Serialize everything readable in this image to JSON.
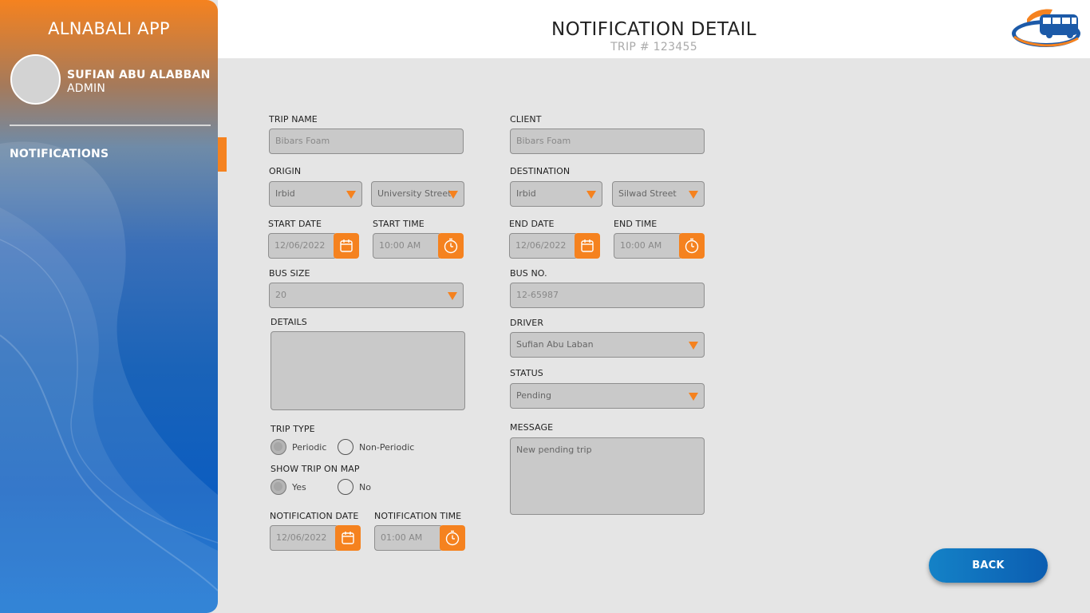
{
  "app": {
    "title": "ALNABALI APP"
  },
  "user": {
    "name": "SUFIAN ABU ALABBAN",
    "role": "ADMIN"
  },
  "nav": {
    "notifications": "NOTIFICATIONS"
  },
  "header": {
    "title": "NOTIFICATION DETAIL",
    "subtitle": "TRIP # 123455"
  },
  "colors": {
    "accent": "#f5821f",
    "primary": "#0b5db1",
    "field_bg": "#c9c9c9",
    "page_bg": "#e5e5e5"
  },
  "form": {
    "trip_name": {
      "label": "TRIP NAME",
      "value": "Bibars Foam"
    },
    "client": {
      "label": "CLIENT",
      "value": "Bibars Foam"
    },
    "origin": {
      "label": "ORIGIN",
      "city": "Irbid",
      "street": "University Street"
    },
    "destination": {
      "label": "DESTINATION",
      "city": "Irbid",
      "street": "Silwad Street"
    },
    "start_date": {
      "label": "START DATE",
      "value": "12/06/2022"
    },
    "start_time": {
      "label": "START TIME",
      "value": "10:00 AM"
    },
    "end_date": {
      "label": "END DATE",
      "value": "12/06/2022"
    },
    "end_time": {
      "label": "END TIME",
      "value": "10:00 AM"
    },
    "bus_size": {
      "label": "BUS SIZE",
      "value": "20"
    },
    "bus_no": {
      "label": "BUS NO.",
      "value": "12-65987"
    },
    "details": {
      "label": "DETAILS",
      "value": ""
    },
    "driver": {
      "label": "DRIVER",
      "value": "Sufian Abu Laban"
    },
    "status": {
      "label": "STATUS",
      "value": "Pending"
    },
    "message": {
      "label": "MESSAGE",
      "value": "New pending trip"
    },
    "trip_type": {
      "label": "TRIP TYPE",
      "options": [
        "Periodic",
        "Non-Periodic"
      ],
      "selected": "Periodic"
    },
    "show_on_map": {
      "label": "SHOW TRIP ON MAP",
      "options": [
        "Yes",
        "No"
      ],
      "selected": "Yes"
    },
    "notification_date": {
      "label": "NOTIFICATION DATE",
      "value": "12/06/2022"
    },
    "notification_time": {
      "label": "NOTIFICATION TIME",
      "value": "01:00 AM"
    }
  },
  "actions": {
    "back": "BACK"
  },
  "icons": {
    "calendar": "calendar-icon",
    "clock": "clock-icon",
    "dropdown": "chevron-down-icon"
  }
}
